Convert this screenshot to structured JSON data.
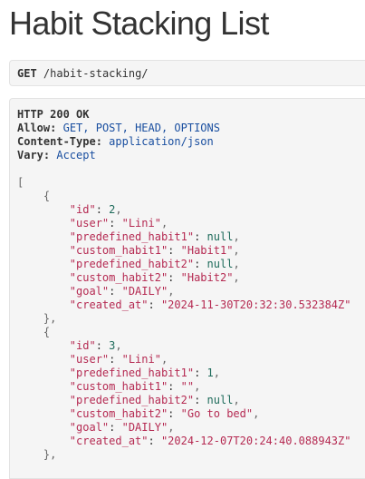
{
  "page": {
    "title": "Habit Stacking List"
  },
  "request": {
    "method": "GET",
    "path": "/habit-stacking/"
  },
  "response": {
    "status": "HTTP 200 OK",
    "headers": [
      {
        "name": "Allow:",
        "value": "GET, POST, HEAD, OPTIONS"
      },
      {
        "name": "Content-Type:",
        "value": "application/json"
      },
      {
        "name": "Vary:",
        "value": "Accept"
      }
    ],
    "open_bracket": "[",
    "items": [
      {
        "id": "2",
        "user": "\"Lini\"",
        "predefined_habit1": "null",
        "custom_habit1": "\"Habit1\"",
        "predefined_habit2": "null",
        "custom_habit2": "\"Habit2\"",
        "goal": "\"DAILY\"",
        "created_at": "\"2024-11-30T20:32:30.532384Z\""
      },
      {
        "id": "3",
        "user": "\"Lini\"",
        "predefined_habit1": "1",
        "custom_habit1": "\"\"",
        "predefined_habit2": "null",
        "custom_habit2": "\"Go to bed\"",
        "goal": "\"DAILY\"",
        "created_at": "\"2024-12-07T20:24:40.088943Z\""
      }
    ],
    "keys": {
      "id": "\"id\"",
      "user": "\"user\"",
      "predefined_habit1": "\"predefined_habit1\"",
      "custom_habit1": "\"custom_habit1\"",
      "predefined_habit2": "\"predefined_habit2\"",
      "custom_habit2": "\"custom_habit2\"",
      "goal": "\"goal\"",
      "created_at": "\"created_at\""
    }
  }
}
